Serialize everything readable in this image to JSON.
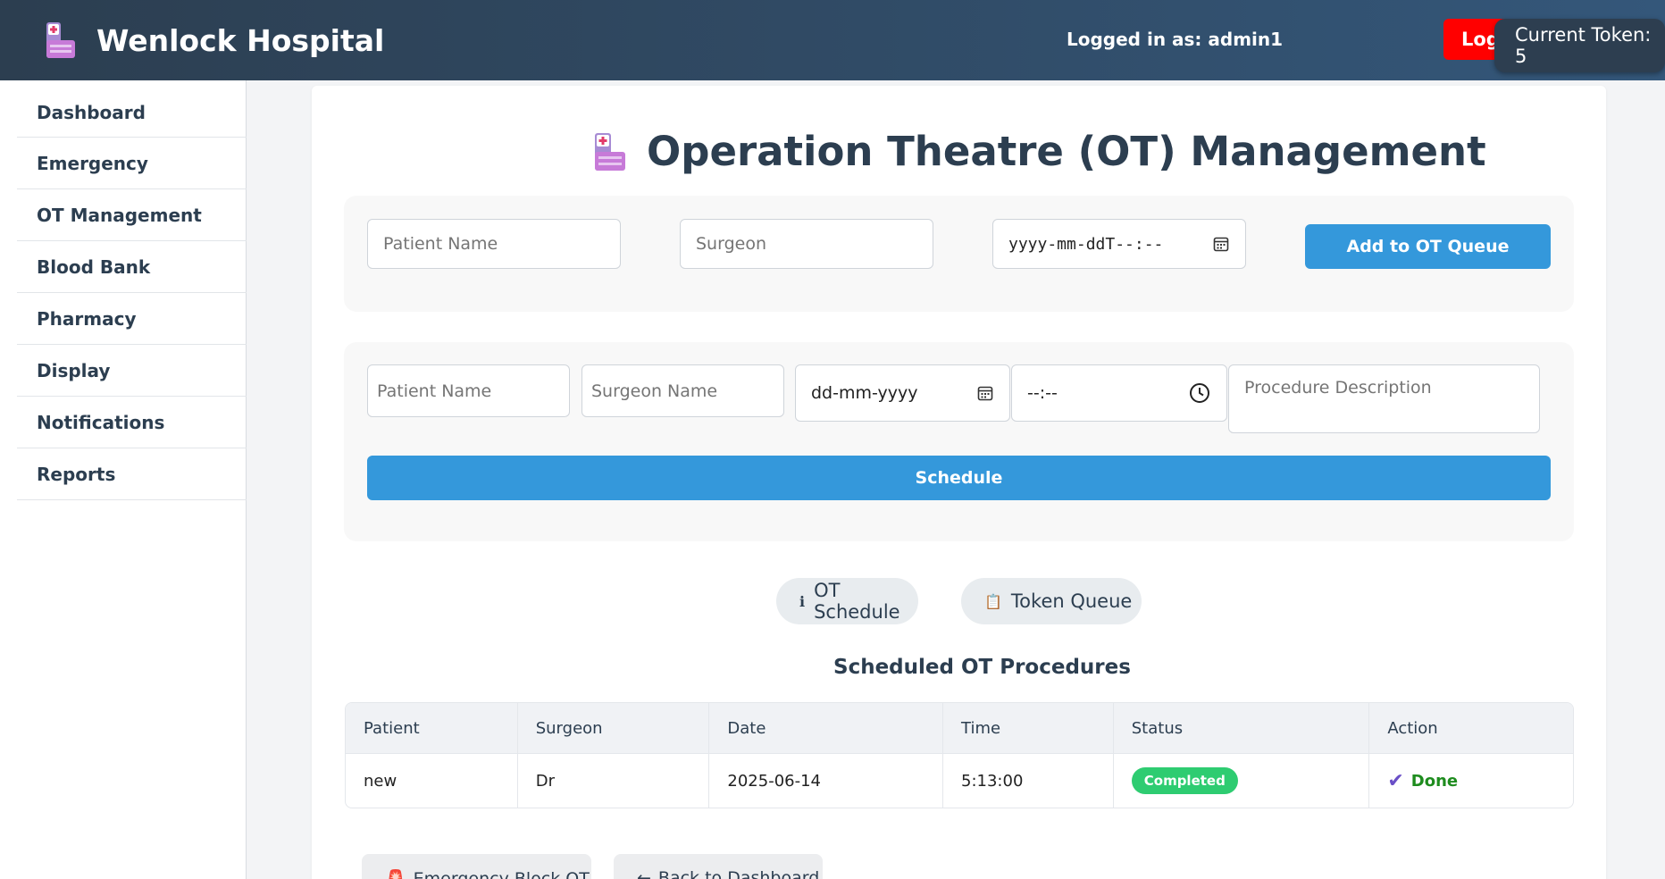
{
  "header": {
    "title": "Wenlock Hospital",
    "logged_in": "Logged in as: admin1",
    "logout_label": "Logout",
    "token": "Current Token: 5"
  },
  "sidebar": {
    "items": [
      {
        "label": "Dashboard"
      },
      {
        "label": "Emergency"
      },
      {
        "label": "OT Management"
      },
      {
        "label": "Blood Bank"
      },
      {
        "label": "Pharmacy"
      },
      {
        "label": "Display"
      },
      {
        "label": "Notifications"
      },
      {
        "label": "Reports"
      }
    ]
  },
  "page": {
    "title": "Operation Theatre (OT) Management"
  },
  "queue_form": {
    "patient_placeholder": "Patient Name",
    "surgeon_placeholder": "Surgeon",
    "datetime_value": "yyyy-mm-ddT--:--",
    "add_label": "Add to OT Queue"
  },
  "schedule_form": {
    "patient_placeholder": "Patient Name",
    "surgeon_placeholder": "Surgeon Name",
    "date_value": "dd-mm-yyyy",
    "time_value": "--:--",
    "procedure_placeholder": "Procedure Description",
    "schedule_label": "Schedule"
  },
  "tabs": {
    "schedule": "OT Schedule",
    "queue": "Token Queue"
  },
  "table": {
    "title": "Scheduled OT Procedures",
    "headers": [
      "Patient",
      "Surgeon",
      "Date",
      "Time",
      "Status",
      "Action"
    ],
    "rows": [
      {
        "patient": "new",
        "surgeon": "Dr",
        "date": "2025-06-14",
        "time": "5:13:00",
        "status": "Completed",
        "action": "Done"
      }
    ]
  },
  "bottom": {
    "emergency_label": "Emergency Block OT",
    "back_label": "Back to Dashboard"
  },
  "colors": {
    "header_start": "#2c3e50",
    "header_end": "#34577a",
    "accent": "#3498db",
    "logout": "#ff0000",
    "status_completed": "#2ecc71",
    "done_text": "#1e8c1e"
  }
}
